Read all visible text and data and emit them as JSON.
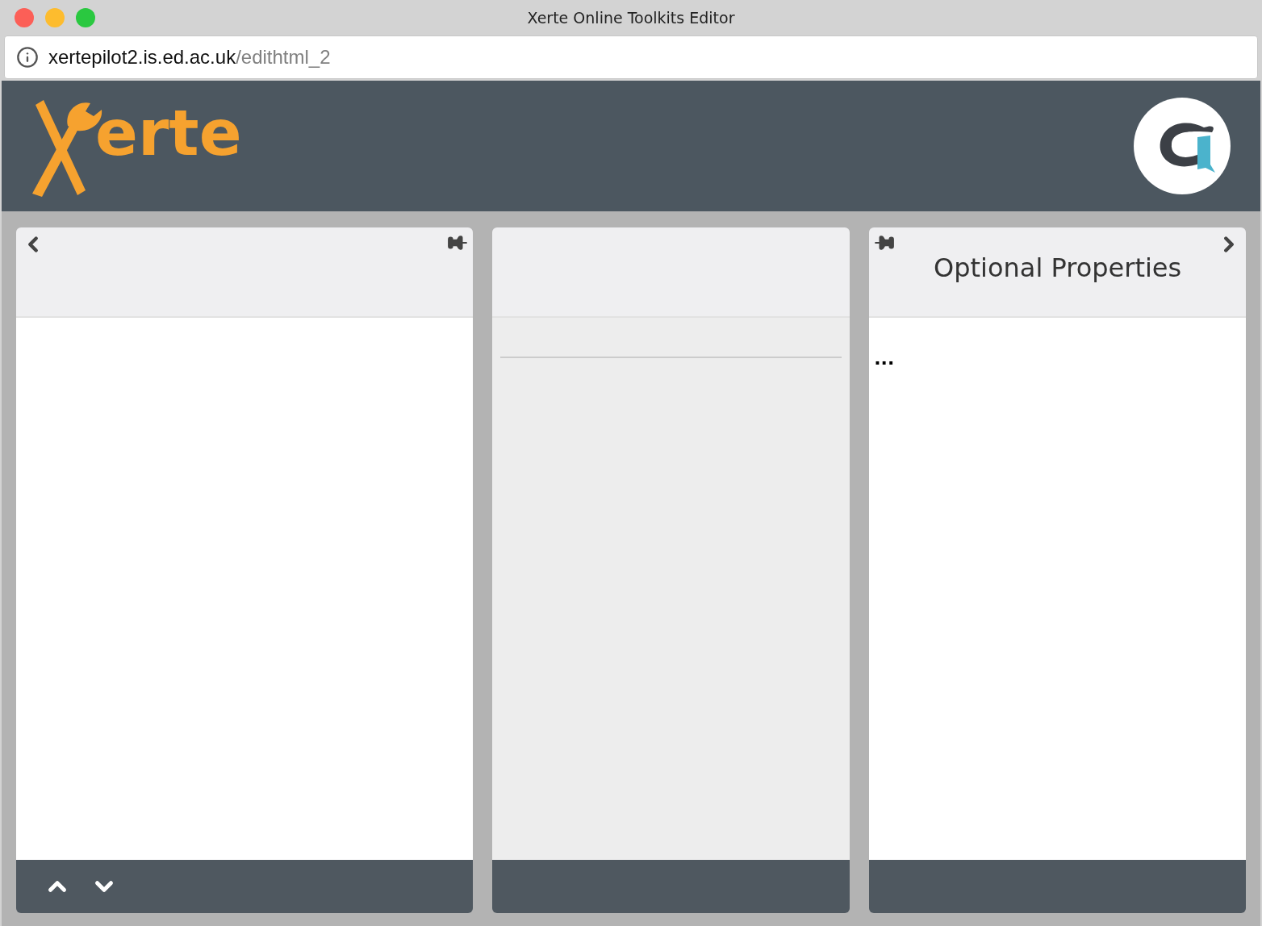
{
  "window": {
    "title": "Xerte Online Toolkits Editor"
  },
  "address_bar": {
    "host": "xertepilot2.is.ed.ac.uk",
    "path": "/edithtml_2"
  },
  "header": {
    "logo_text": "erte"
  },
  "panels": [
    {
      "kind": "left"
    },
    {
      "kind": "middle"
    },
    {
      "kind": "right",
      "title": "Optional Properties",
      "body_text": "..."
    }
  ]
}
